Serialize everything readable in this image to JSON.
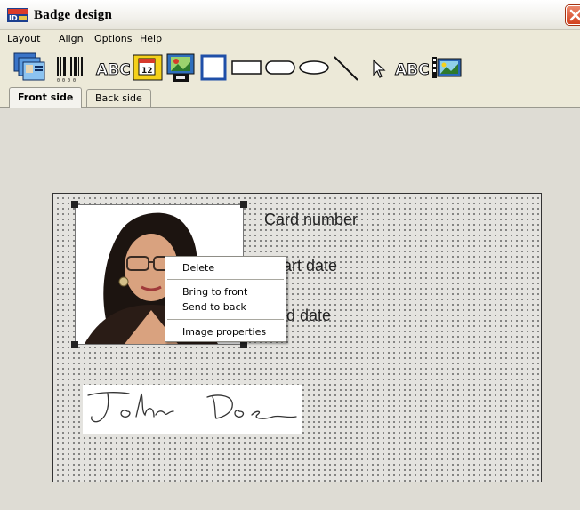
{
  "window": {
    "title": "Badge design"
  },
  "menu": [
    {
      "label": "Layout"
    },
    {
      "label": "Align"
    },
    {
      "label": "Options"
    },
    {
      "label": "Help"
    }
  ],
  "toolbar": {
    "tools": [
      {
        "icon": "cards-stack-icon"
      },
      {
        "icon": "barcode-icon"
      },
      {
        "icon": "text-abc-icon",
        "glyph": "ABC"
      },
      {
        "icon": "date-calendar-icon"
      },
      {
        "icon": "image-import-icon"
      },
      {
        "icon": "square-icon"
      },
      {
        "icon": "rectangle-icon"
      },
      {
        "icon": "rounded-rectangle-icon"
      },
      {
        "icon": "ellipse-icon"
      },
      {
        "icon": "line-icon"
      },
      {
        "icon": "pointer-arrow-icon"
      },
      {
        "icon": "text-field-abc-icon",
        "glyph": "ABC"
      },
      {
        "icon": "picture-icon"
      }
    ]
  },
  "tabs": [
    {
      "label": "Front side",
      "active": true
    },
    {
      "label": "Back side",
      "active": false
    }
  ],
  "badge": {
    "fields": {
      "card_number": "Card number",
      "start_date": "Start date",
      "end_date": "End date",
      "start_date_visible": "art date",
      "end_date_visible": "d date"
    },
    "signature_icon": "signature-image"
  },
  "context_menu": {
    "items": [
      {
        "label": "Delete"
      },
      {
        "label": "Bring to front"
      },
      {
        "label": "Send to back"
      },
      {
        "label": "Image properties"
      }
    ]
  },
  "colors": {
    "accent_blue": "#1f4fa8",
    "close_red": "#d2401d",
    "canvas": "#e4e3df",
    "panel": "#dedcd4"
  }
}
